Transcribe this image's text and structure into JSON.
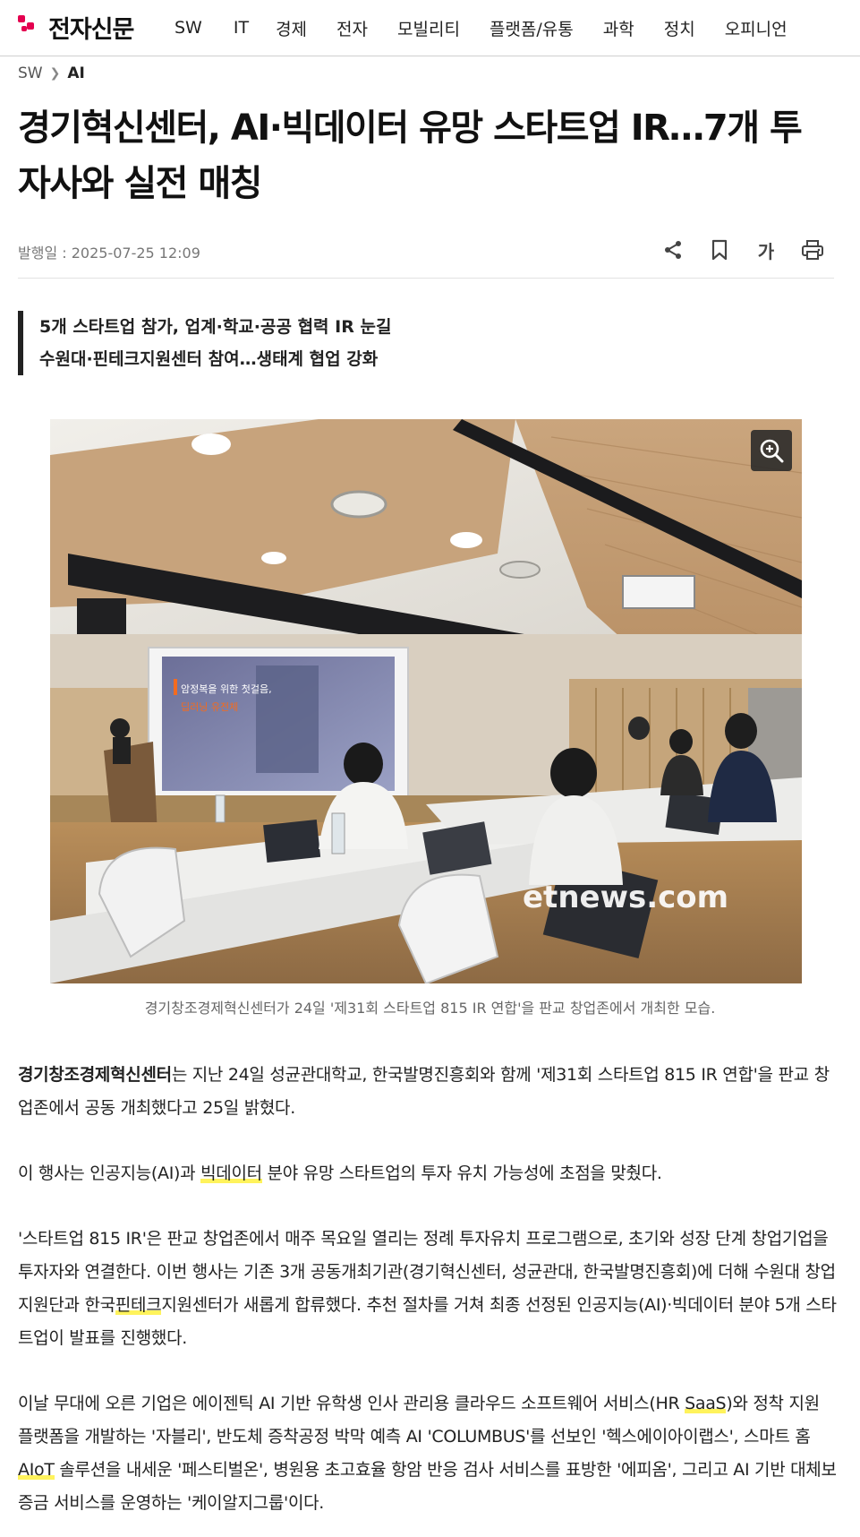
{
  "brand": {
    "name": "전자신문",
    "accent": "#e4004f"
  },
  "nav": {
    "items": [
      "SW",
      "IT",
      "경제",
      "전자",
      "모빌리티",
      "플랫폼/유통",
      "과학",
      "정치",
      "오피니언"
    ]
  },
  "breadcrumb": {
    "section": "SW",
    "current": "AI"
  },
  "article": {
    "title": "경기혁신센터, AI·빅데이터 유망 스타트업 IR…7개 투자사와 실전 매칭",
    "published": "발행일 : 2025-07-25 12:09",
    "font_button": "가",
    "summary": [
      "5개 스타트업 참가, 업계·학교·공공 협력 IR 눈길",
      "수원대·핀테크지원센터 참여…생태계 협업 강화"
    ],
    "photo": {
      "slide_line1": "암정복을 위한 첫걸음,",
      "slide_line2": "딥러닝 유전체",
      "watermark": "etnews.com"
    },
    "caption": "경기창조경제혁신센터가 24일 '제31회 스타트업 815 IR 연합'을 판교 창업존에서 개최한 모습.",
    "p1": {
      "bold": "경기창조경제혁신센터",
      "rest": "는 지난 24일 성균관대학교, 한국발명진흥회와 함께 '제31회 스타트업 815 IR 연합'을 판교 창업존에서 공동 개최했다고 25일 밝혔다."
    },
    "p2": {
      "a": "이 행사는 인공지능(AI)과 ",
      "link": "빅데이터",
      "b": " 분야 유망 스타트업의 투자 유치 가능성에 초점을 맞췄다."
    },
    "p3": {
      "a": "'스타트업 815 IR'은 판교 창업존에서 매주 목요일 열리는 정례 투자유치 프로그램으로, 초기와 성장 단계 창업기업을 투자자와 연결한다. 이번 행사는 기존 3개 공동개최기관(경기혁신센터, 성균관대, 한국발명진흥회)에 더해 수원대 창업지원단과 한국",
      "link": "핀테크",
      "b": "지원센터가 새롭게 합류했다. 추천 절차를 거쳐 최종 선정된 인공지능(AI)·빅데이터 분야 5개 스타트업이 발표를 진행했다."
    },
    "p4": {
      "a": "이날 무대에 오른 기업은 에이젠틱 AI 기반 유학생 인사 관리용 클라우드 소프트웨어 서비스(HR ",
      "link1": "SaaS",
      "b": ")와 정착 지원 플랫폼을 개발하는 '자블리', 반도체 증착공정 박막 예측 AI 'COLUMBUS'를 선보인 '헥스에이아이랩스', 스마트 홈 ",
      "link2": "AIoT",
      "c": " 솔루션을 내세운 '페스티벌온', 병원용 초고효율 항암 반응 검사 서비스를 표방한 '에피옴', 그리고 AI 기반 대체보증금 서비스를 운영하는 '케이알지그룹'이다."
    }
  }
}
